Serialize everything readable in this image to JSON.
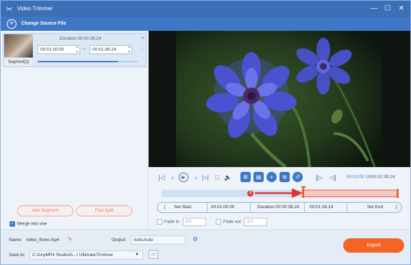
{
  "window": {
    "title": "Video Trimmer"
  },
  "toolbar": {
    "change_source": "Change Source File"
  },
  "segment": {
    "label": "Segment[1]",
    "duration": "Duration:00:00:39.24",
    "start": "00:01:00.00",
    "end": "00:01:39.24",
    "progress": 0.8
  },
  "left_actions": {
    "add_segment": "Add Segment",
    "fast_split": "Fast Split",
    "merge_label": "Merge into one",
    "merge_checked": true
  },
  "playback": {
    "current_time": "00:01:00.10",
    "total_time": "/00:01:39.24",
    "marker_label": "3"
  },
  "trim": {
    "set_start": "Set Start",
    "start_time": "00:01:00.00",
    "duration": "Duration:00:00:39.24",
    "end_time": "00:01:39.24",
    "set_end": "Set End"
  },
  "fade": {
    "fade_in_label": "Fade in",
    "fade_in_value": "3.0",
    "fade_out_label": "Fade out",
    "fade_out_value": "3.0"
  },
  "output": {
    "name_label": "Name:",
    "name_value": "video_three.mp4",
    "output_label": "Output:",
    "output_value": "Auto;Auto",
    "save_label": "Save to:",
    "save_value": "C:\\AnyMP4 Studio\\A...r Ultimate\\Trimmer",
    "export": "Export"
  },
  "colors": {
    "title_bar": "#3b6fb8",
    "accent": "#3e78c5",
    "export": "#f26522",
    "selection": "#f5c8c4"
  }
}
